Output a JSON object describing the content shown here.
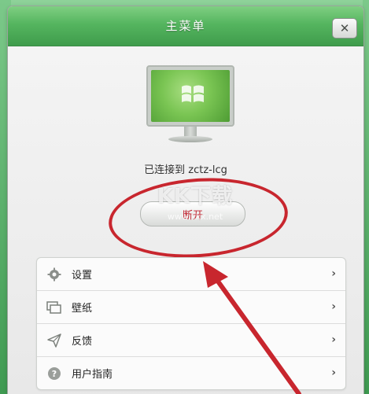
{
  "window": {
    "title": "主菜单",
    "close_label": "✕"
  },
  "status": {
    "text": "已连接到 zctz-lcg"
  },
  "disconnect": {
    "label": "断开"
  },
  "watermark": {
    "text": "KK下载",
    "url": "www.kkx.net"
  },
  "menu": {
    "items": [
      {
        "label": "设置",
        "icon": "gear-icon"
      },
      {
        "label": "壁纸",
        "icon": "wallpaper-icon"
      },
      {
        "label": "反馈",
        "icon": "paper-plane-icon"
      },
      {
        "label": "用户指南",
        "icon": "help-icon"
      }
    ],
    "chevron": "›"
  },
  "colors": {
    "title_bar": "#55b55f",
    "annotation_red": "#c8262e",
    "disconnect_text": "#c0232f"
  }
}
